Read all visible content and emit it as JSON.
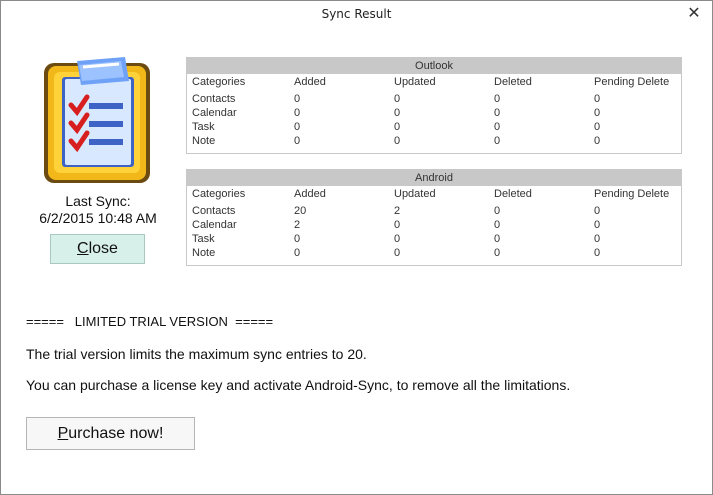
{
  "window": {
    "title": "Sync Result",
    "close_symbol": "✕"
  },
  "sidebar": {
    "last_sync_label": "Last Sync:",
    "last_sync_value": "6/2/2015 10:48 AM",
    "close_button": {
      "accel": "C",
      "rest": "lose"
    }
  },
  "outlook": {
    "title": "Outlook",
    "columns": [
      "Categories",
      "Added",
      "Updated",
      "Deleted",
      "Pending Delete"
    ],
    "rows": [
      [
        "Contacts",
        "0",
        "0",
        "0",
        "0"
      ],
      [
        "Calendar",
        "0",
        "0",
        "0",
        "0"
      ],
      [
        "Task",
        "0",
        "0",
        "0",
        "0"
      ],
      [
        "Note",
        "0",
        "0",
        "0",
        "0"
      ]
    ]
  },
  "android": {
    "title": "Android",
    "columns": [
      "Categories",
      "Added",
      "Updated",
      "Deleted",
      "Pending Delete"
    ],
    "rows": [
      [
        "Contacts",
        "20",
        "2",
        "0",
        "0"
      ],
      [
        "Calendar",
        "2",
        "0",
        "0",
        "0"
      ],
      [
        "Task",
        "0",
        "0",
        "0",
        "0"
      ],
      [
        "Note",
        "0",
        "0",
        "0",
        "0"
      ]
    ]
  },
  "trial": {
    "banner": "=====   LIMITED TRIAL VERSION  =====",
    "line1": "The trial version limits the maximum sync entries to 20.",
    "line2": "You can purchase a license key and activate Android-Sync, to remove all the limitations.",
    "purchase_button": {
      "accel": "P",
      "rest": "urchase now!"
    }
  },
  "icons": {
    "app": "checklist-clipboard-icon",
    "close": "close-icon"
  },
  "colors": {
    "close_button_bg": "#d8f0ea",
    "grid_header_bg": "#c8c8c8",
    "icon_frame": "#f2b81a",
    "icon_check": "#d81f1f",
    "icon_paper": "#5a8ef0"
  }
}
